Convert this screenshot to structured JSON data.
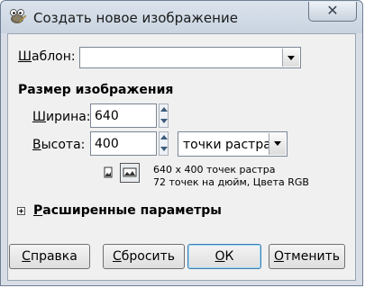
{
  "window": {
    "title": "Создать новое изображение",
    "close_icon": "close-icon",
    "app_icon": "gimp-icon"
  },
  "template": {
    "label_underlined": "Ш",
    "label_rest": "аблон:",
    "value": ""
  },
  "image_size": {
    "heading": "Размер изображения",
    "width_label_underlined": "Ш",
    "width_label_rest": "ирина:",
    "width_value": "640",
    "height_label_underlined": "В",
    "height_label_rest": "ысота:",
    "height_value": "400",
    "unit": "точки растра",
    "info_line1": "640 x 400 точек растра",
    "info_line2": "72 точек на дюйм, Цвета RGB"
  },
  "advanced": {
    "label_underlined": "Р",
    "label_rest": "асширенные параметры"
  },
  "buttons": {
    "help_underlined": "С",
    "help_rest": "правка",
    "reset_underlined": "С",
    "reset_rest": "бросить",
    "ok_underlined": "О",
    "ok_rest": "К",
    "cancel_underlined": "О",
    "cancel_rest": "тменить"
  }
}
